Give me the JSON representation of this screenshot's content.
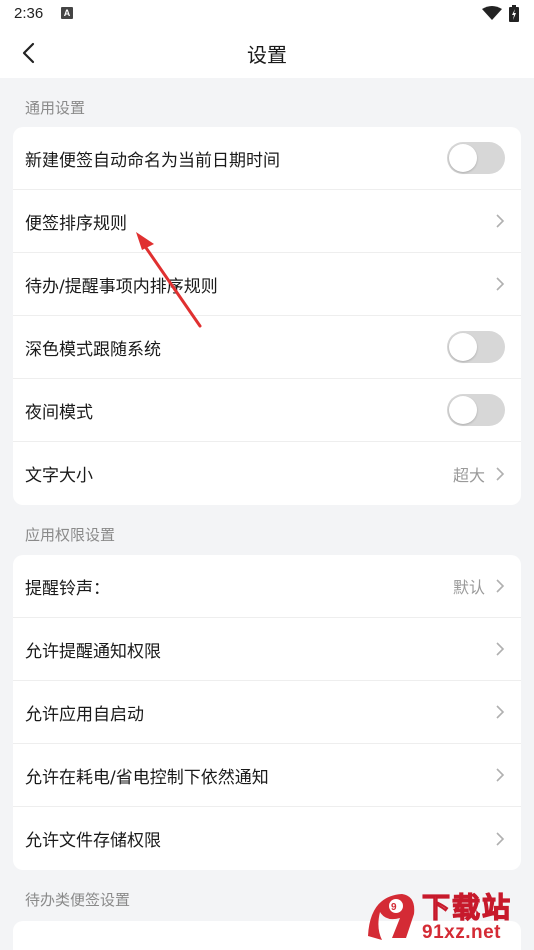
{
  "status_bar": {
    "time": "2:36",
    "notification_icon": "A"
  },
  "header": {
    "title": "设置",
    "back_icon": "chevron-left"
  },
  "sections": [
    {
      "title": "通用设置",
      "rows": [
        {
          "label": "新建便签自动命名为当前日期时间",
          "control": "toggle",
          "on": false
        },
        {
          "label": "便签排序规则",
          "control": "chevron"
        },
        {
          "label": "待办/提醒事项内排序规则",
          "control": "chevron"
        },
        {
          "label": "深色模式跟随系统",
          "control": "toggle",
          "on": false
        },
        {
          "label": "夜间模式",
          "control": "toggle",
          "on": false
        },
        {
          "label": "文字大小",
          "value": "超大",
          "control": "chevron"
        }
      ]
    },
    {
      "title": "应用权限设置",
      "rows": [
        {
          "label": "提醒铃声：",
          "value": "默认",
          "control": "chevron"
        },
        {
          "label": "允许提醒通知权限",
          "control": "chevron"
        },
        {
          "label": "允许应用自启动",
          "control": "chevron"
        },
        {
          "label": "允许在耗电/省电控制下依然通知",
          "control": "chevron"
        },
        {
          "label": "允许文件存储权限",
          "control": "chevron"
        }
      ]
    },
    {
      "title": "待办类便签设置",
      "rows": []
    }
  ],
  "watermark": {
    "title": "下载站",
    "url": "91xz.net",
    "badge": "9"
  },
  "colors": {
    "background": "#f3f4f6",
    "card": "#ffffff",
    "toggle_off": "#d7d7d7",
    "annotation_arrow": "#e03030",
    "watermark_red": "#c7192b"
  }
}
